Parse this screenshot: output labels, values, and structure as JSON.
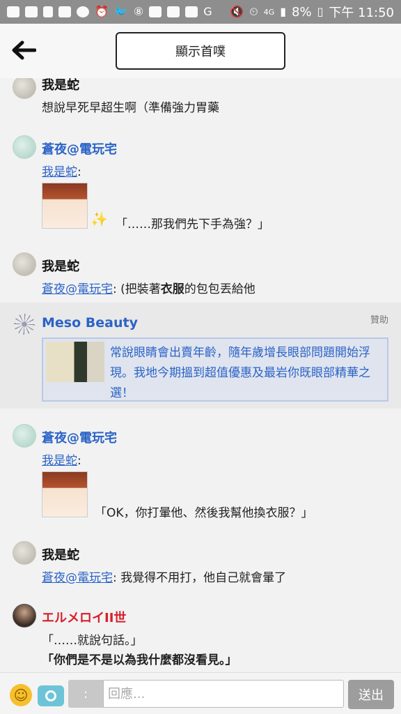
{
  "status_bar": {
    "left_icons": [
      "message-icon",
      "facebook-icon",
      "file-icon",
      "bag-icon",
      "telegram-icon",
      "alarm-icon",
      "twitter-icon",
      "badge-8-icon",
      "image-icon",
      "app-icon",
      "app-icon",
      "google-icon"
    ],
    "badge_number": "8",
    "battery": "8%",
    "time": "下午 11:50",
    "network": "4G"
  },
  "header": {
    "title": "顯示首噗"
  },
  "comments": [
    {
      "name": "我是蛇",
      "text": "想說早死早超生啊（準備強力胃藥"
    },
    {
      "name": "蒼夜@電玩宅",
      "reply_to": "我是蛇",
      "text": "「……那我們先下手為強？」"
    },
    {
      "name": "我是蛇",
      "reply_to": "蒼夜@電玩宅",
      "text_before": ": (把裝著",
      "text_bold": "衣服",
      "text_after": "的包包丟給他"
    },
    {
      "name": "蒼夜@電玩宅",
      "reply_to": "我是蛇",
      "text": "「OK，你打暈他、然後我幫他換衣服？」"
    },
    {
      "name": "我是蛇",
      "reply_to": "蒼夜@電玩宅",
      "text": ": 我覺得不用打，他自己就會暈了"
    },
    {
      "name": "エルメロイII世",
      "line1": "「……就說句話。」",
      "line2": "「你們是不是以為我什麼都沒看見。」"
    }
  ],
  "ad": {
    "brand": "Meso Beauty",
    "sponsor_label": "贊助",
    "text": "常說眼睛會出賣年齡，隨年歲增長眼部問題開始浮現。我地今期搵到超值優惠及最岩你既眼部精華之選！"
  },
  "input_bar": {
    "qualifier": ":",
    "placeholder": "回應...",
    "send_label": "送出"
  },
  "colors": {
    "link": "#2b63c7",
    "red_name": "#d6202a",
    "status_bar": "#8e8e8e"
  }
}
